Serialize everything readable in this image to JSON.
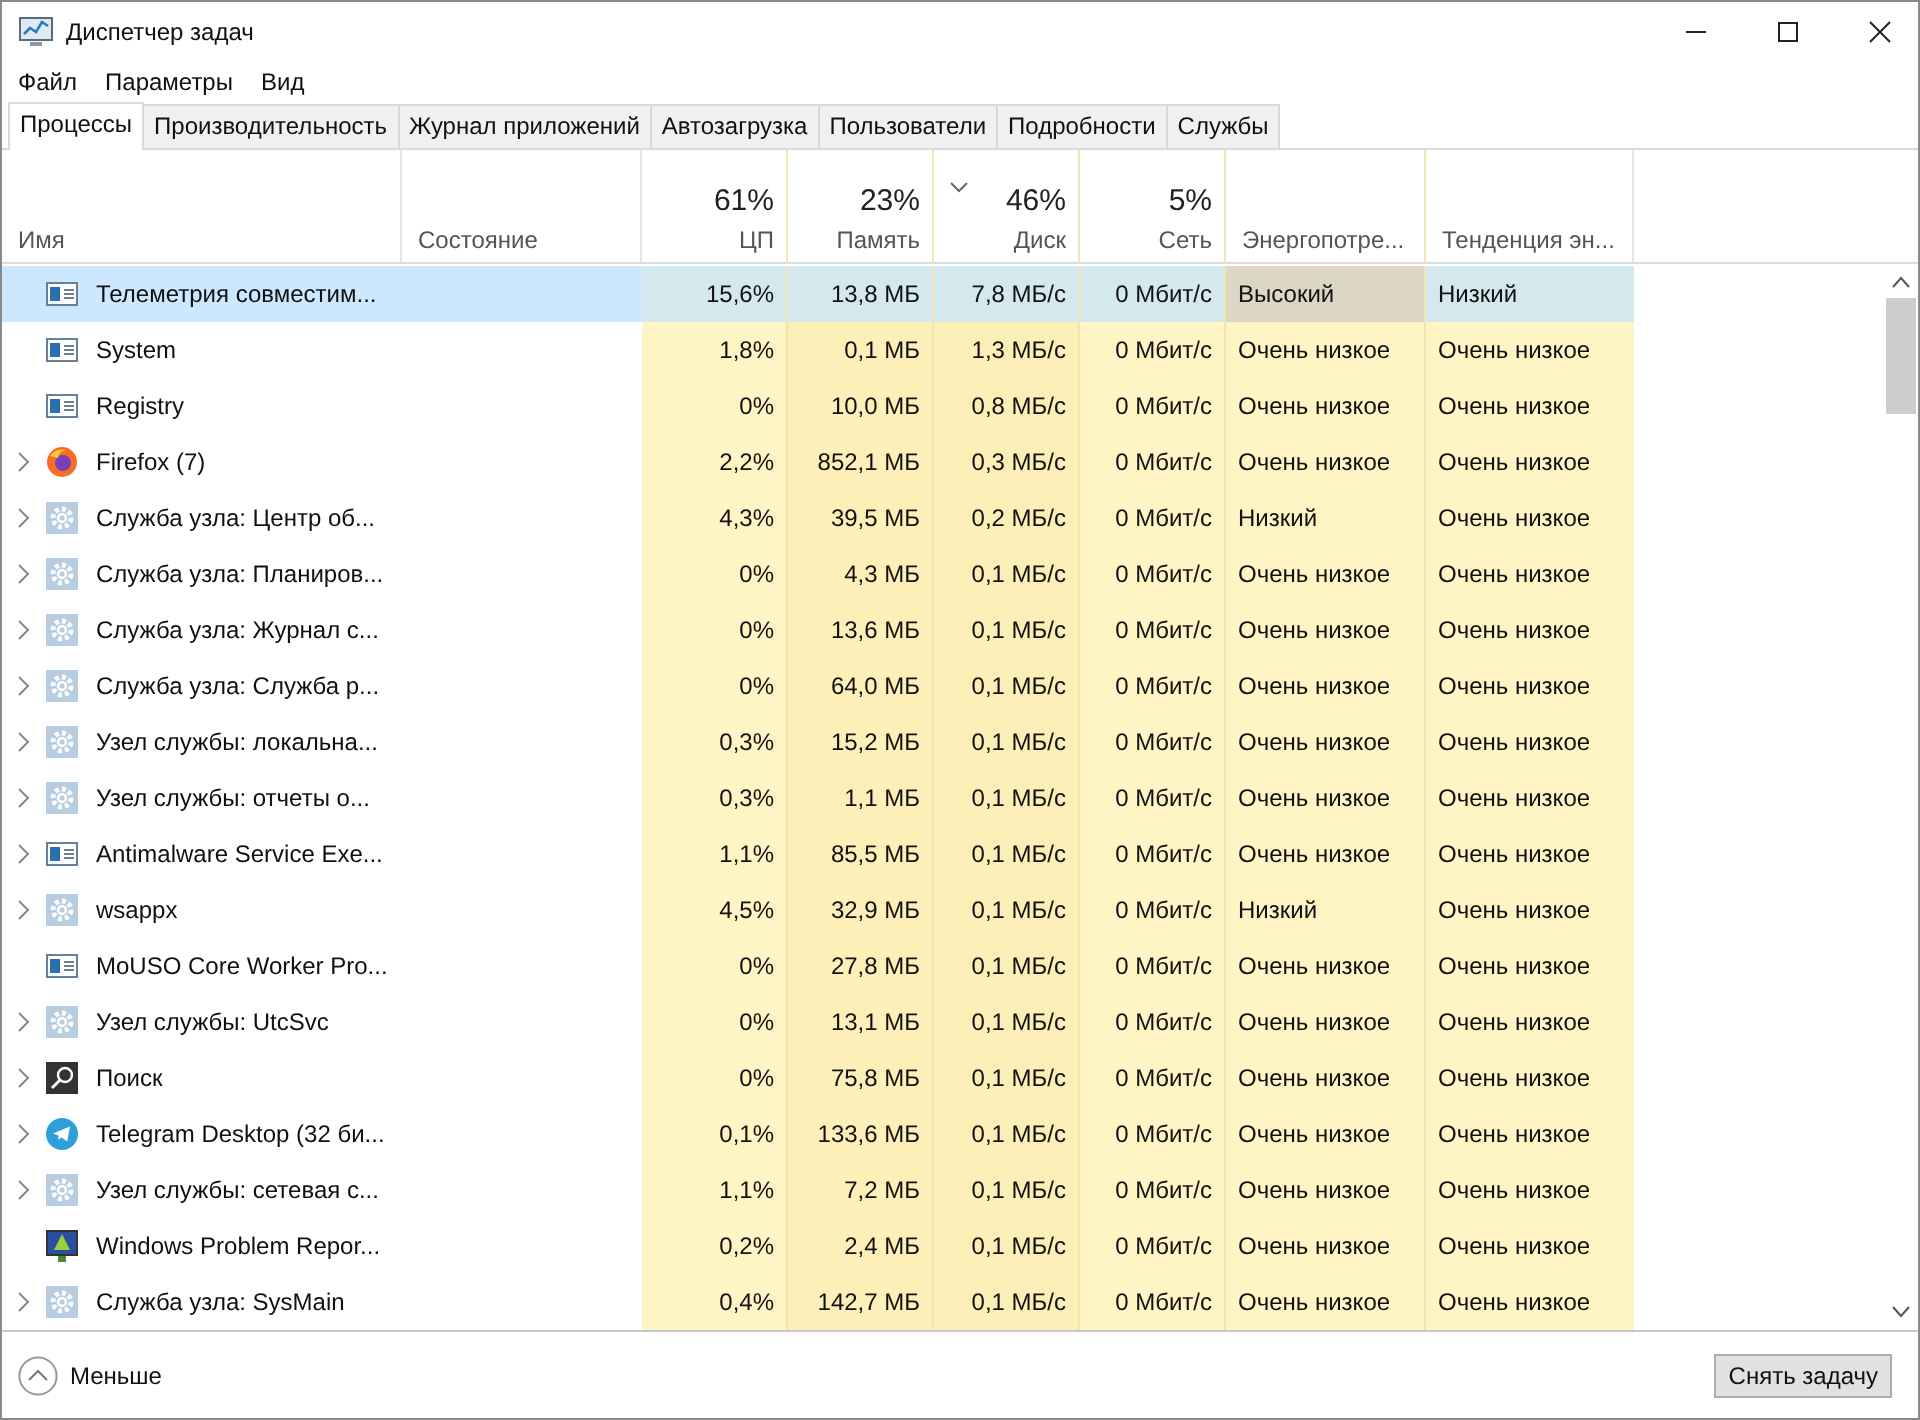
{
  "window": {
    "title": "Диспетчер задач"
  },
  "menu": [
    "Файл",
    "Параметры",
    "Вид"
  ],
  "tabs": [
    {
      "label": "Процессы",
      "selected": true
    },
    {
      "label": "Производительность",
      "selected": false
    },
    {
      "label": "Журнал приложений",
      "selected": false
    },
    {
      "label": "Автозагрузка",
      "selected": false
    },
    {
      "label": "Пользователи",
      "selected": false
    },
    {
      "label": "Подробности",
      "selected": false
    },
    {
      "label": "Службы",
      "selected": false
    }
  ],
  "columns": [
    {
      "label": "Имя",
      "sorted": false
    },
    {
      "label": "Состояние",
      "sorted": false
    },
    {
      "label": "ЦП",
      "total": "61%",
      "sorted": false
    },
    {
      "label": "Память",
      "total": "23%",
      "sorted": false
    },
    {
      "label": "Диск",
      "total": "46%",
      "sorted": true
    },
    {
      "label": "Сеть",
      "total": "5%",
      "sorted": false
    },
    {
      "label": "Энергопотре...",
      "sorted": false
    },
    {
      "label": "Тенденция эн...",
      "sorted": false
    }
  ],
  "rows": [
    {
      "name": "Телеметрия совместим...",
      "kind": "app",
      "expandable": false,
      "selected": true,
      "cells": [
        "15,6%",
        "13,8 МБ",
        "7,8 МБ/с",
        "0 Мбит/с",
        "Высокий",
        "Низкий"
      ]
    },
    {
      "name": "System",
      "kind": "app",
      "expandable": false,
      "selected": false,
      "cells": [
        "1,8%",
        "0,1 МБ",
        "1,3 МБ/с",
        "0 Мбит/с",
        "Очень низкое",
        "Очень низкое"
      ]
    },
    {
      "name": "Registry",
      "kind": "app",
      "expandable": false,
      "selected": false,
      "cells": [
        "0%",
        "10,0 МБ",
        "0,8 МБ/с",
        "0 Мбит/с",
        "Очень низкое",
        "Очень низкое"
      ]
    },
    {
      "name": "Firefox (7)",
      "kind": "browser",
      "expandable": true,
      "selected": false,
      "cells": [
        "2,2%",
        "852,1 МБ",
        "0,3 МБ/с",
        "0 Мбит/с",
        "Очень низкое",
        "Очень низкое"
      ]
    },
    {
      "name": "Служба узла: Центр об...",
      "kind": "gear",
      "expandable": true,
      "selected": false,
      "cells": [
        "4,3%",
        "39,5 МБ",
        "0,2 МБ/с",
        "0 Мбит/с",
        "Низкий",
        "Очень низкое"
      ]
    },
    {
      "name": "Служба узла: Планиров...",
      "kind": "gear",
      "expandable": true,
      "selected": false,
      "cells": [
        "0%",
        "4,3 МБ",
        "0,1 МБ/с",
        "0 Мбит/с",
        "Очень низкое",
        "Очень низкое"
      ]
    },
    {
      "name": "Служба узла: Журнал с...",
      "kind": "gear",
      "expandable": true,
      "selected": false,
      "cells": [
        "0%",
        "13,6 МБ",
        "0,1 МБ/с",
        "0 Мбит/с",
        "Очень низкое",
        "Очень низкое"
      ]
    },
    {
      "name": "Служба узла: Служба р...",
      "kind": "gear",
      "expandable": true,
      "selected": false,
      "cells": [
        "0%",
        "64,0 МБ",
        "0,1 МБ/с",
        "0 Мбит/с",
        "Очень низкое",
        "Очень низкое"
      ]
    },
    {
      "name": "Узел службы: локальна...",
      "kind": "gear",
      "expandable": true,
      "selected": false,
      "cells": [
        "0,3%",
        "15,2 МБ",
        "0,1 МБ/с",
        "0 Мбит/с",
        "Очень низкое",
        "Очень низкое"
      ]
    },
    {
      "name": "Узел службы: отчеты о...",
      "kind": "gear",
      "expandable": true,
      "selected": false,
      "cells": [
        "0,3%",
        "1,1 МБ",
        "0,1 МБ/с",
        "0 Мбит/с",
        "Очень низкое",
        "Очень низкое"
      ]
    },
    {
      "name": "Antimalware Service Exe...",
      "kind": "app",
      "expandable": true,
      "selected": false,
      "cells": [
        "1,1%",
        "85,5 МБ",
        "0,1 МБ/с",
        "0 Мбит/с",
        "Очень низкое",
        "Очень низкое"
      ]
    },
    {
      "name": "wsappx",
      "kind": "gear",
      "expandable": true,
      "selected": false,
      "cells": [
        "4,5%",
        "32,9 МБ",
        "0,1 МБ/с",
        "0 Мбит/с",
        "Низкий",
        "Очень низкое"
      ]
    },
    {
      "name": "MoUSO Core Worker Pro...",
      "kind": "app",
      "expandable": false,
      "selected": false,
      "cells": [
        "0%",
        "27,8 МБ",
        "0,1 МБ/с",
        "0 Мбит/с",
        "Очень низкое",
        "Очень низкое"
      ]
    },
    {
      "name": "Узел службы: UtcSvc",
      "kind": "gear",
      "expandable": true,
      "selected": false,
      "cells": [
        "0%",
        "13,1 МБ",
        "0,1 МБ/с",
        "0 Мбит/с",
        "Очень низкое",
        "Очень низкое"
      ]
    },
    {
      "name": "Поиск",
      "kind": "search",
      "expandable": true,
      "selected": false,
      "cells": [
        "0%",
        "75,8 МБ",
        "0,1 МБ/с",
        "0 Мбит/с",
        "Очень низкое",
        "Очень низкое"
      ]
    },
    {
      "name": "Telegram Desktop (32 би...",
      "kind": "messenger",
      "expandable": true,
      "selected": false,
      "cells": [
        "0,1%",
        "133,6 МБ",
        "0,1 МБ/с",
        "0 Мбит/с",
        "Очень низкое",
        "Очень низкое"
      ]
    },
    {
      "name": "Узел службы: сетевая с...",
      "kind": "gear",
      "expandable": true,
      "selected": false,
      "cells": [
        "1,1%",
        "7,2 МБ",
        "0,1 МБ/с",
        "0 Мбит/с",
        "Очень низкое",
        "Очень низкое"
      ]
    },
    {
      "name": "Windows Problem Repor...",
      "kind": "report",
      "expandable": false,
      "selected": false,
      "cells": [
        "0,2%",
        "2,4 МБ",
        "0,1 МБ/с",
        "0 Мбит/с",
        "Очень низкое",
        "Очень низкое"
      ]
    },
    {
      "name": "Служба узла: SysMain",
      "kind": "gear",
      "expandable": true,
      "selected": false,
      "cells": [
        "0,4%",
        "142,7 МБ",
        "0,1 МБ/с",
        "0 Мбит/с",
        "Очень низкое",
        "Очень низкое"
      ]
    }
  ],
  "footer": {
    "toggle": "Меньше",
    "end_task": "Снять задачу"
  }
}
